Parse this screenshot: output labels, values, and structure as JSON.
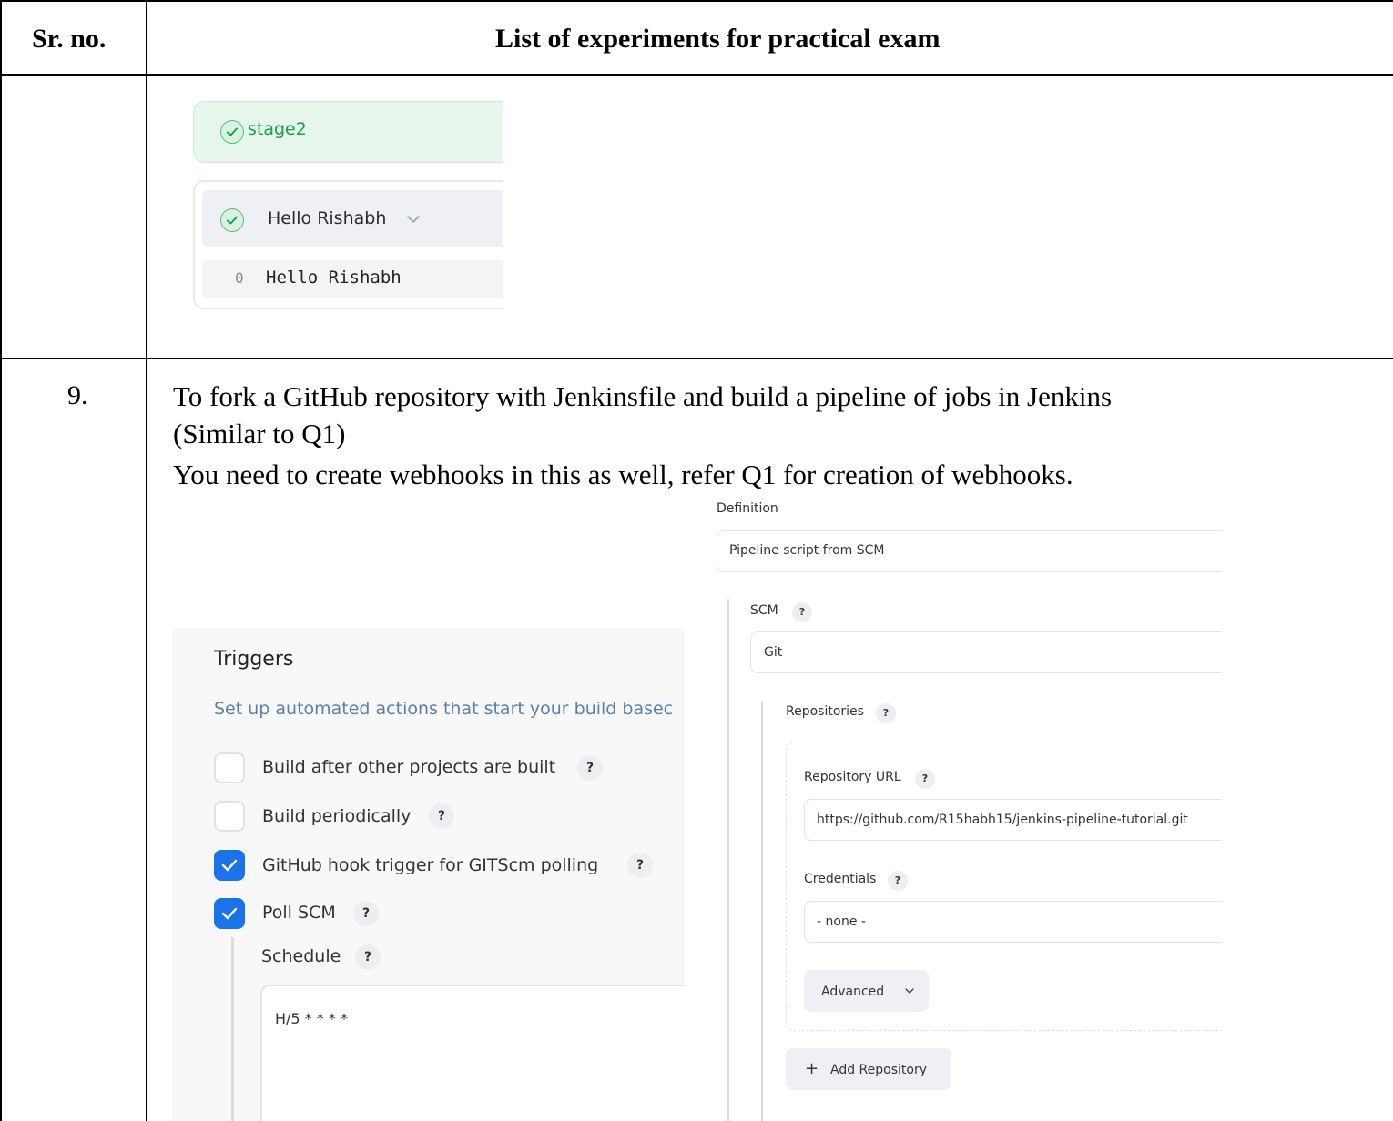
{
  "table": {
    "header_col1": "Sr. no.",
    "header_col2": "List of experiments for practical exam",
    "row2_number": "9.",
    "row2_line1": "To fork a GitHub repository with Jenkinsfile and build a pipeline of jobs in Jenkins",
    "row2_line2": "(Similar to Q1)",
    "row2_line3": "You need to create webhooks in this as well, refer Q1 for creation of webhooks."
  },
  "pipeline_view": {
    "stage_name": "stage2",
    "step_name": "Hello Rishabh",
    "log_line_number": "0",
    "log_text": "Hello Rishabh",
    "success_color": "#17a34a"
  },
  "triggers": {
    "title": "Triggers",
    "description": "Set up automated actions that start your build basec",
    "options": [
      {
        "label": "Build after other projects are built",
        "checked": false
      },
      {
        "label": "Build periodically",
        "checked": false
      },
      {
        "label": "GitHub hook trigger for GITScm polling",
        "checked": true
      },
      {
        "label": "Poll SCM",
        "checked": true
      }
    ],
    "schedule_label": "Schedule",
    "schedule_value": "H/5 * * * *",
    "help_glyph": "?",
    "accent_color": "#1a73e8"
  },
  "definition": {
    "label": "Definition",
    "value": "Pipeline script from SCM",
    "scm_label": "SCM",
    "scm_value": "Git",
    "repositories_label": "Repositories",
    "repo_url_label": "Repository URL",
    "repo_url_value": "https://github.com/R15habh15/jenkins-pipeline-tutorial.git",
    "credentials_label": "Credentials",
    "credentials_value": "- none -",
    "advanced_label": "Advanced",
    "add_repository_label": "Add Repository",
    "add_glyph": "+"
  }
}
